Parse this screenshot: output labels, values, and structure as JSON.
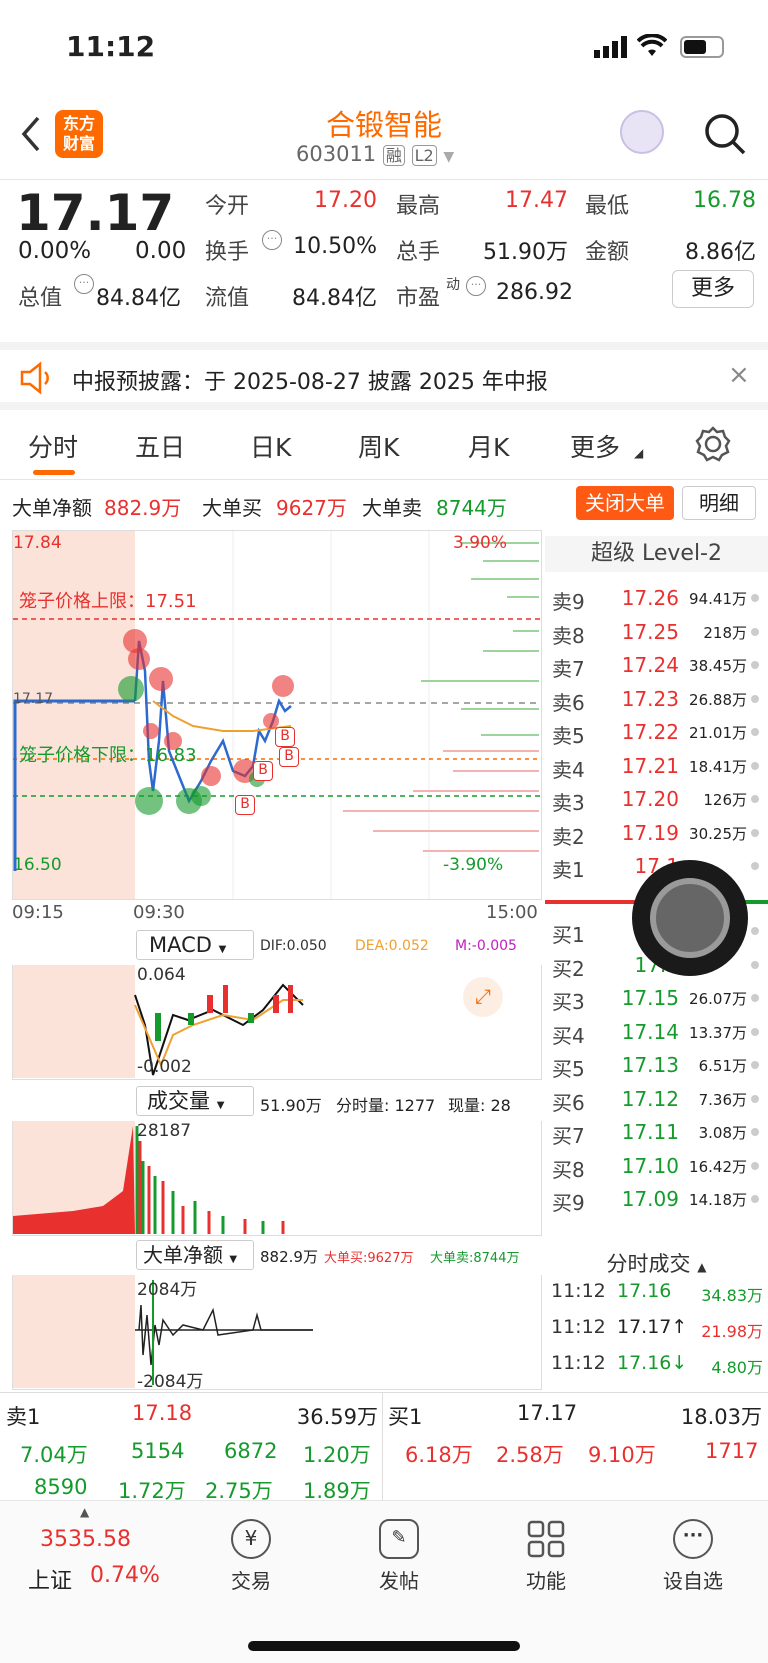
{
  "status_bar": {
    "time": "11:12"
  },
  "header": {
    "title": "合锻智能",
    "code": "603011",
    "badge_rong": "融",
    "badge_l2": "L2",
    "logo_text": "东方财富"
  },
  "quote": {
    "price": "17.17",
    "change_pct": "0.00%",
    "change": "0.00",
    "open_label": "今开",
    "open": "17.20",
    "high_label": "最高",
    "high": "17.47",
    "low_label": "最低",
    "low": "16.78",
    "turnover_label": "换手",
    "turnover": "10.50%",
    "volume_label": "总手",
    "volume": "51.90万",
    "amount_label": "金额",
    "amount": "8.86亿",
    "mktcap_label": "总值",
    "mktcap": "84.84亿",
    "float_label": "流值",
    "float": "84.84亿",
    "pe_label": "市盈",
    "pe_sup": "动",
    "pe": "286.92",
    "more_button": "更多"
  },
  "notice": {
    "text": "中报预披露：于 2025-08-27 披露 2025 年中报"
  },
  "tabs": [
    "分时",
    "五日",
    "日K",
    "周K",
    "月K",
    "更多"
  ],
  "dadan": {
    "net_label": "大单净额",
    "net": "882.9万",
    "buy_label": "大单买",
    "buy": "9627万",
    "sell_label": "大单卖",
    "sell": "8744万",
    "close_button": "关闭大单",
    "detail_button": "明细"
  },
  "chart": {
    "y_max": "17.84",
    "y_min": "16.50",
    "pct_max": "3.90%",
    "pct_min": "-3.90%",
    "upper_limit_label": "笼子价格上限：17.51",
    "lower_limit_label": "笼子价格下限：16.83",
    "time_start": "09:15",
    "time_open": "09:30",
    "time_end": "15:00",
    "mark": "17.17",
    "colors": {
      "up": "#e8312f",
      "down": "#159a2c",
      "avg": "#f0a030"
    }
  },
  "macd": {
    "select": "MACD",
    "dif": "DIF:0.050",
    "dea": "DEA:0.052",
    "m": "M:-0.005",
    "top": "0.064",
    "bottom": "-0.002"
  },
  "volume": {
    "select": "成交量",
    "total": "51.90万",
    "fenshi": "分时量: 1277",
    "xianliang": "现量: 28",
    "top": "28187"
  },
  "dadan_chart": {
    "select": "大单净额",
    "net": "882.9万",
    "buy": "大单买:9627万",
    "sell": "大单卖:8744万",
    "top": "2084万",
    "bottom": "-2084万"
  },
  "level2": {
    "title": "超级 Level-2",
    "asks": [
      {
        "label": "卖9",
        "price": "17.26",
        "vol": "94.41万"
      },
      {
        "label": "卖8",
        "price": "17.25",
        "vol": "218万"
      },
      {
        "label": "卖7",
        "price": "17.24",
        "vol": "38.45万"
      },
      {
        "label": "卖6",
        "price": "17.23",
        "vol": "26.88万"
      },
      {
        "label": "卖5",
        "price": "17.22",
        "vol": "21.01万"
      },
      {
        "label": "卖4",
        "price": "17.21",
        "vol": "18.41万"
      },
      {
        "label": "卖3",
        "price": "17.20",
        "vol": "126万"
      },
      {
        "label": "卖2",
        "price": "17.19",
        "vol": "30.25万"
      },
      {
        "label": "卖1",
        "price": "17.1",
        "vol": ""
      }
    ],
    "bids": [
      {
        "label": "买1",
        "price": "1",
        "vol": ""
      },
      {
        "label": "买2",
        "price": "17.1",
        "vol": ""
      },
      {
        "label": "买3",
        "price": "17.15",
        "vol": "26.07万"
      },
      {
        "label": "买4",
        "price": "17.14",
        "vol": "13.37万"
      },
      {
        "label": "买5",
        "price": "17.13",
        "vol": "6.51万"
      },
      {
        "label": "买6",
        "price": "17.12",
        "vol": "7.36万"
      },
      {
        "label": "买7",
        "price": "17.11",
        "vol": "3.08万"
      },
      {
        "label": "买8",
        "price": "17.10",
        "vol": "16.42万"
      },
      {
        "label": "买9",
        "price": "17.09",
        "vol": "14.18万"
      }
    ],
    "ticks_title": "分时成交",
    "ticks": [
      {
        "time": "11:12",
        "price": "17.16",
        "vol": "34.83万"
      },
      {
        "time": "11:12",
        "price": "17.17↑",
        "vol": "21.98万"
      },
      {
        "time": "11:12",
        "price": "17.16↓",
        "vol": "4.80万"
      }
    ]
  },
  "summary": {
    "sell1_label": "卖1",
    "sell1_price": "17.18",
    "sell1_vol": "36.59万",
    "buy1_label": "买1",
    "buy1_price": "17.17",
    "buy1_vol": "18.03万",
    "row2": [
      "7.04万",
      "5154",
      "6872",
      "1.20万",
      "6.18万",
      "2.58万",
      "9.10万",
      "1717"
    ],
    "row3": [
      "8590",
      "1.72万",
      "2.75万",
      "1.89万"
    ]
  },
  "bottom": {
    "index_value": "3535.58",
    "index_name": "上证",
    "index_pct": "0.74%",
    "trade": "交易",
    "post": "发帖",
    "function": "功能",
    "watch": "设自选"
  }
}
